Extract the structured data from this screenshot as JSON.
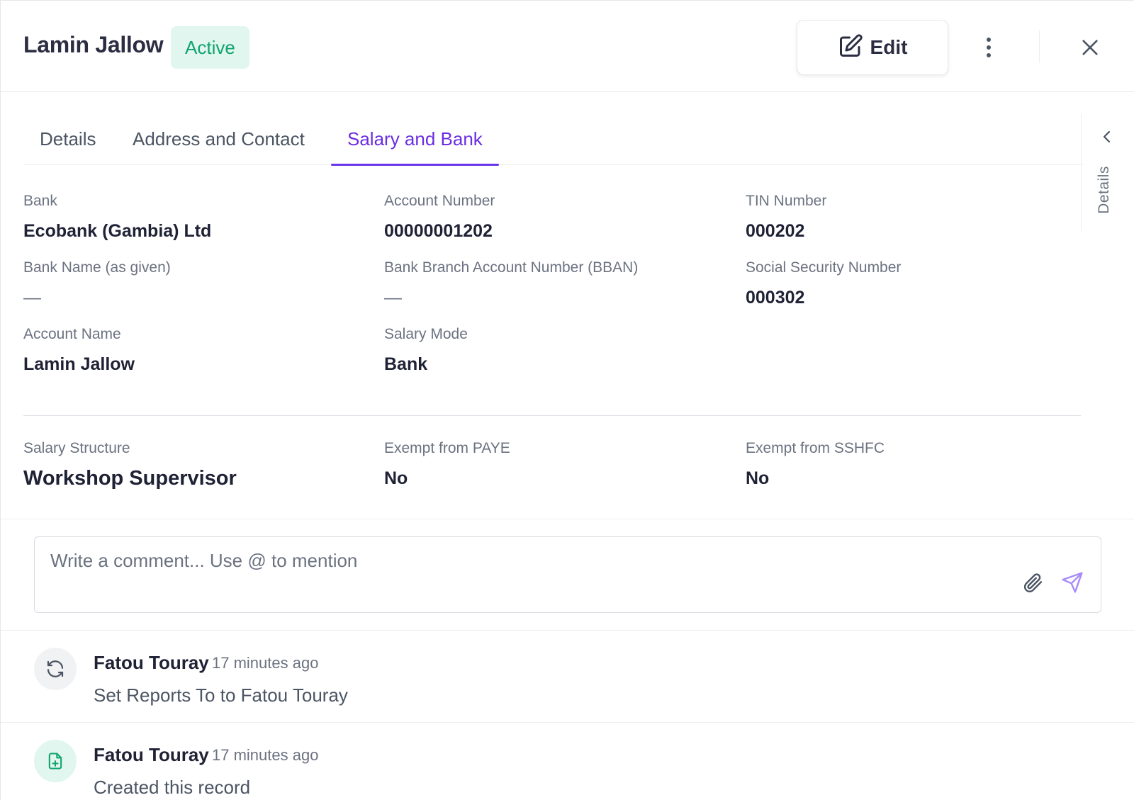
{
  "header": {
    "employee_name": "Lamin Jallow",
    "status": "Active",
    "edit_label": "Edit",
    "icons": {
      "edit": "edit-icon",
      "more": "more-vertical-icon",
      "close": "close-icon"
    }
  },
  "tabs": [
    {
      "label": "Details",
      "active": false
    },
    {
      "label": "Address and Contact",
      "active": false
    },
    {
      "label": "Salary and Bank",
      "active": true
    }
  ],
  "side_rail": {
    "label": "Details",
    "icon": "chevron-left-icon"
  },
  "bank_fields": {
    "bank": {
      "label": "Bank",
      "value": "Ecobank (Gambia) Ltd"
    },
    "account_number": {
      "label": "Account Number",
      "value": "00000001202"
    },
    "tin_number": {
      "label": "TIN Number",
      "value": "000202"
    },
    "bank_name_given": {
      "label": "Bank Name (as given)",
      "value": "—"
    },
    "bban": {
      "label": "Bank Branch Account Number (BBAN)",
      "value": "—"
    },
    "ssn": {
      "label": "Social Security Number",
      "value": "000302"
    },
    "account_name": {
      "label": "Account Name",
      "value": "Lamin Jallow"
    },
    "salary_mode": {
      "label": "Salary Mode",
      "value": "Bank"
    }
  },
  "salary_fields": {
    "salary_structure": {
      "label": "Salary Structure",
      "value": "Workshop Supervisor"
    },
    "exempt_paye": {
      "label": "Exempt from PAYE",
      "value": "No"
    },
    "exempt_sshfc": {
      "label": "Exempt from SSHFC",
      "value": "No"
    }
  },
  "comment": {
    "placeholder": "Write a comment... Use @ to mention",
    "icons": {
      "attach": "paperclip-icon",
      "send": "send-icon"
    }
  },
  "activity": [
    {
      "author": "Fatou Touray",
      "time": "17 minutes ago",
      "message": "Set Reports To to Fatou Touray",
      "icon": "refresh-icon"
    },
    {
      "author": "Fatou Touray",
      "time": "17 minutes ago",
      "message": "Created this record",
      "icon": "file-plus-icon"
    }
  ],
  "colors": {
    "accent": "#6b2ee0",
    "status_bg": "#e0f6ef",
    "status_text": "#12a46f",
    "send_icon": "#a78bfa"
  }
}
